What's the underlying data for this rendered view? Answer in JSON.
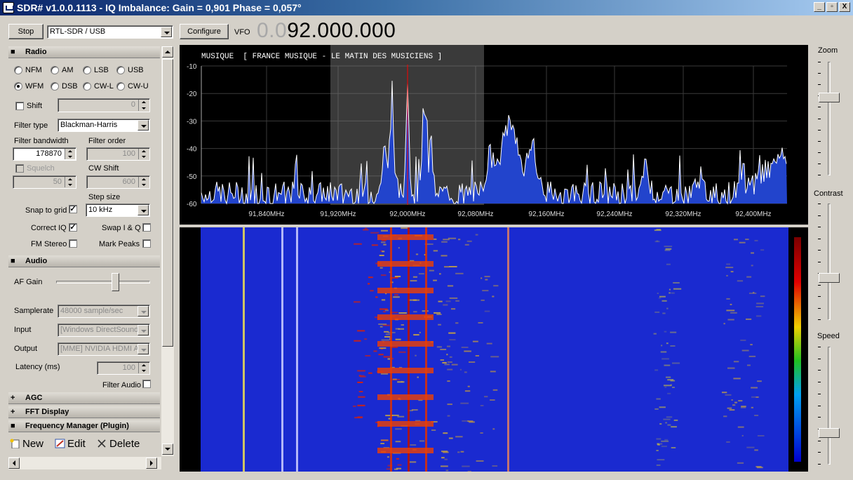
{
  "window": {
    "title": "SDR# v1.0.0.1113 - IQ Imbalance: Gain = 0,901 Phase = 0,057°",
    "minimize": "_",
    "maximize": "▫",
    "close": "X"
  },
  "toolbar": {
    "stop_label": "Stop",
    "device_value": "RTL-SDR / USB",
    "configure_label": "Configure",
    "vfo_label": "VFO",
    "vfo_dim": "0.0",
    "vfo_main": "92.000.000"
  },
  "radio": {
    "title": "Radio",
    "toggle": "■",
    "modes": [
      {
        "label": "NFM",
        "selected": false
      },
      {
        "label": "AM",
        "selected": false
      },
      {
        "label": "LSB",
        "selected": false
      },
      {
        "label": "USB",
        "selected": false
      },
      {
        "label": "WFM",
        "selected": true
      },
      {
        "label": "DSB",
        "selected": false
      },
      {
        "label": "CW-L",
        "selected": false
      },
      {
        "label": "CW-U",
        "selected": false
      }
    ],
    "shift_label": "Shift",
    "shift_value": "0",
    "filter_type_label": "Filter type",
    "filter_type_value": "Blackman-Harris",
    "filter_bandwidth_label": "Filter bandwidth",
    "filter_bandwidth_value": "178870",
    "filter_order_label": "Filter order",
    "filter_order_value": "100",
    "squelch_label": "Squelch",
    "squelch_value": "50",
    "cw_shift_label": "CW Shift",
    "cw_shift_value": "600",
    "step_size_label": "Step size",
    "step_size_value": "10 kHz",
    "snap_label": "Snap to grid",
    "snap_checked": "✓",
    "correct_iq_label": "Correct IQ",
    "correct_iq_checked": "✓",
    "swap_iq_label": "Swap I & Q",
    "fm_stereo_label": "FM Stereo",
    "mark_peaks_label": "Mark Peaks"
  },
  "audio": {
    "title": "Audio",
    "toggle": "■",
    "af_gain_label": "AF Gain",
    "af_gain_level": 0.64,
    "samplerate_label": "Samplerate",
    "samplerate_value": "48000 sample/sec",
    "input_label": "Input",
    "input_value": "[Windows DirectSound]",
    "output_label": "Output",
    "output_value": "[MME] NVIDIA HDMI A",
    "latency_label": "Latency (ms)",
    "latency_value": "100",
    "filter_audio_label": "Filter Audio"
  },
  "sections": [
    {
      "title": "AGC",
      "toggle": "+"
    },
    {
      "title": "FFT Display",
      "toggle": "+"
    },
    {
      "title": "Frequency Manager (Plugin)",
      "toggle": "■"
    }
  ],
  "freqman": {
    "new_label": "New",
    "edit_label": "Edit",
    "delete_label": "Delete"
  },
  "right_panel": {
    "zoom_label": "Zoom",
    "contrast_label": "Contrast",
    "speed_label": "Speed",
    "zoom_level": 0.7,
    "contrast_level": 0.35,
    "speed_level": 0.25
  },
  "spectrum": {
    "rds_text": "MUSIQUE  [ FRANCE MUSIQUE - LE MATIN DES MUSICIENS ]",
    "y_labels": [
      "-10",
      "-20",
      "-30",
      "-40",
      "-50",
      "-60"
    ],
    "x_labels": [
      "91,840MHz",
      "91,920MHz",
      "92,000MHz",
      "92,080MHz",
      "92,160MHz",
      "92,240MHz",
      "92,320MHz",
      "92,400MHz"
    ],
    "colors": {
      "background": "#000000",
      "fill": "#2244cc",
      "line": "#ffffff",
      "grid": "#3a3a3a",
      "filter": "#808080",
      "center": "#ff0000"
    }
  },
  "waterfall": {
    "colors": {
      "background": "#1a2ad0",
      "hot": "#e02000",
      "warm": "#f0c020"
    }
  }
}
